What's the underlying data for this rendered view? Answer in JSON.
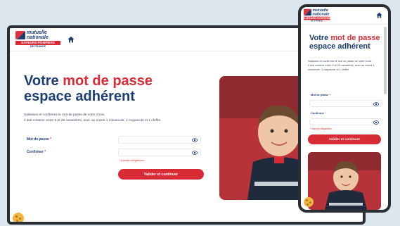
{
  "brand": {
    "name_line1": "mutuelle",
    "name_line2": "nationale",
    "band": "SAPEURS-POMPIERS",
    "sub": "DE FRANCE"
  },
  "page": {
    "title_part1": "Votre ",
    "title_accent": "mot de passe",
    "title_line2": "espace adhérent",
    "desc_line1": "Saisissez et confirmez le mot de passe de votre choix.",
    "desc_line2": "Il doit contenir entre 8 et 25 caractères, avec au moins 1 minuscule, 1 majuscule et 1 chiffre.",
    "password_label": "Mot de passe",
    "confirm_label": "Confirmer",
    "required_mark": "*",
    "mandatory_note": "* champs obligatoires",
    "submit_label": "Valider et continuer"
  },
  "mobile": {
    "title_accent": "mot de passe",
    "title_line2": "espace adhérent",
    "desc_line1": "Saisissez et confirmez le mot de passe de votre choix.",
    "desc_line2": "Il doit contenir entre 8 et 25 caractères, avec au moins 1 minuscule, 1 majuscule et 1 chiffre."
  },
  "icons": [
    "home-icon",
    "eye-icon",
    "cookie-icon"
  ],
  "colors": {
    "navy": "#1d3e73",
    "red": "#d72c35",
    "background": "#dbe6ef"
  }
}
